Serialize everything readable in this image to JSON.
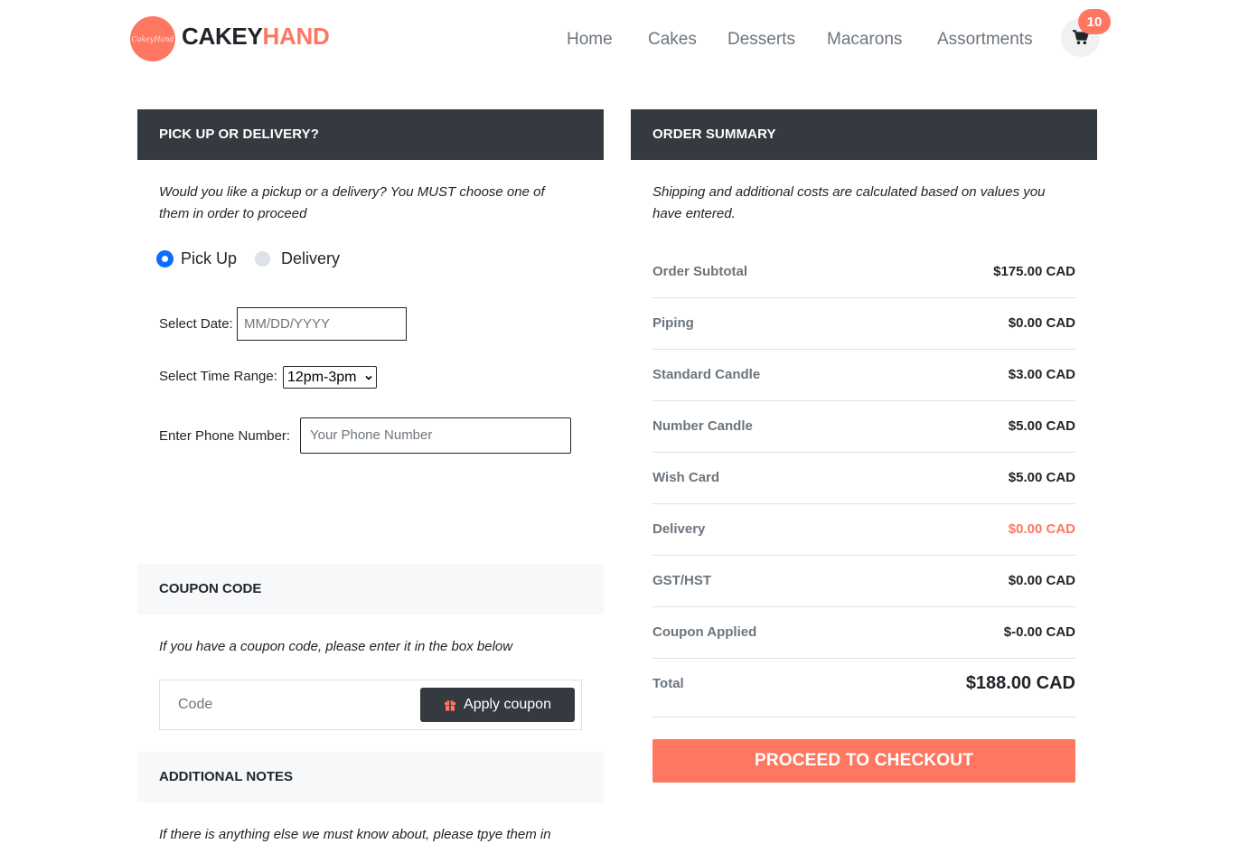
{
  "brand": {
    "logo_text": "CakeyHand",
    "name_part1": "CAKEY",
    "name_part2": "HAND"
  },
  "nav": {
    "items": [
      "Home",
      "Cakes",
      "Desserts",
      "Macarons",
      "Assortments"
    ],
    "cart_count": "10",
    "cart_icon": "shopping-cart-icon"
  },
  "pickup": {
    "heading": "PICK UP OR DELIVERY?",
    "description_line1": "Would you like a pickup or a delivery? You MUST choose one of",
    "description_line2": "them in order to proceed",
    "options": [
      {
        "label": "Pick Up",
        "checked": true
      },
      {
        "label": "Delivery",
        "checked": false
      }
    ],
    "date_label": "Select Date:",
    "date_placeholder": "MM/DD/YYYY",
    "time_label": "Select Time Range:",
    "time_value": "12pm-3pm",
    "phone_label": "Enter Phone Number:",
    "phone_placeholder": "Your Phone Number"
  },
  "coupon": {
    "heading": "COUPON CODE",
    "description": "If you have a coupon code, please enter it in the box below",
    "input_placeholder": "Code",
    "button_label": "Apply coupon",
    "button_icon": "gift-icon"
  },
  "notes": {
    "heading": "ADDITIONAL NOTES",
    "description": "If there is anything else we must know about, please tpye them in"
  },
  "summary": {
    "heading": "ORDER SUMMARY",
    "description_line1": "Shipping and additional costs are calculated based on values you",
    "description_line2": "have entered.",
    "rows": [
      {
        "label": "Order Subtotal",
        "value": "$175.00 CAD"
      },
      {
        "label": "Piping",
        "value": "$0.00 CAD"
      },
      {
        "label": "Standard Candle",
        "value": "$3.00 CAD"
      },
      {
        "label": "Number Candle",
        "value": "$5.00 CAD"
      },
      {
        "label": "Wish Card",
        "value": "$5.00 CAD"
      },
      {
        "label": "Delivery",
        "value": "$0.00 CAD"
      },
      {
        "label": "GST/HST",
        "value": "$0.00 CAD"
      },
      {
        "label": "Coupon Applied",
        "value": "$-0.00 CAD"
      }
    ],
    "total_label": "Total",
    "total_value": "$188.00 CAD",
    "checkout_label": "PROCEED TO CHECKOUT"
  },
  "colors": {
    "accent": "#ff7761",
    "dark": "#343a40",
    "radio_checked": "#0d6efd"
  }
}
